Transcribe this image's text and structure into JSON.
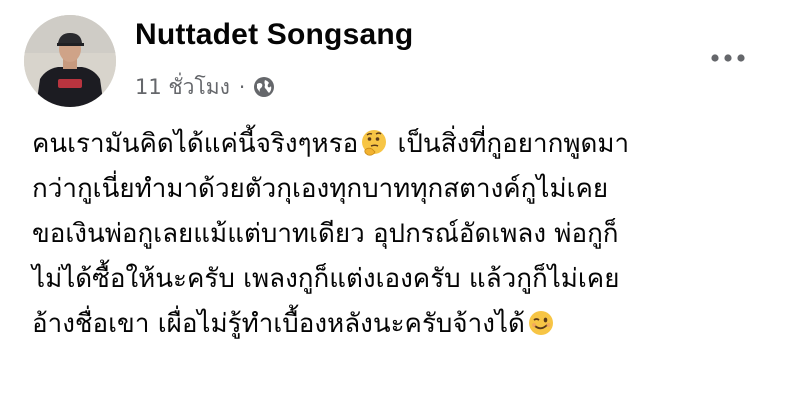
{
  "post": {
    "author": {
      "name": "Nuttadet Songsang",
      "avatar_icon": "profile-photo"
    },
    "meta": {
      "timestamp": "11 ชั่วโมง",
      "separator": "·",
      "privacy_icon": "globe-icon"
    },
    "more_icon": "more-options-icon",
    "body_lines": [
      {
        "text": "คนเรามันคิดได้แค่นี้จริงๆหรอ",
        "emoji": "thinking-face-emoji",
        "text_after": " เป็นสิ่งที่กูอยากพูดมา"
      },
      {
        "text": "กว่ากูเนี่ยทำมาด้วยตัวกุเองทุกบาททุกสตางค์กูไม่เคย"
      },
      {
        "text": "ขอเงินพ่อกูเลยแม้แต่บาทเดียว อุปกรณ์อัดเพลง พ่อกูก็"
      },
      {
        "text": "ไม่ได้ซื้อให้นะครับ เพลงกูก็แต่งเองครับ แล้วกูก็ไม่เคย"
      },
      {
        "text": "อ้างชื่อเขา เผื่อไม่รู้ทำเบื้องหลังนะครับจ้างได้",
        "emoji": "winking-face-emoji"
      }
    ]
  },
  "colors": {
    "text_primary": "#050505",
    "text_secondary": "#65676b",
    "background": "#ffffff"
  }
}
